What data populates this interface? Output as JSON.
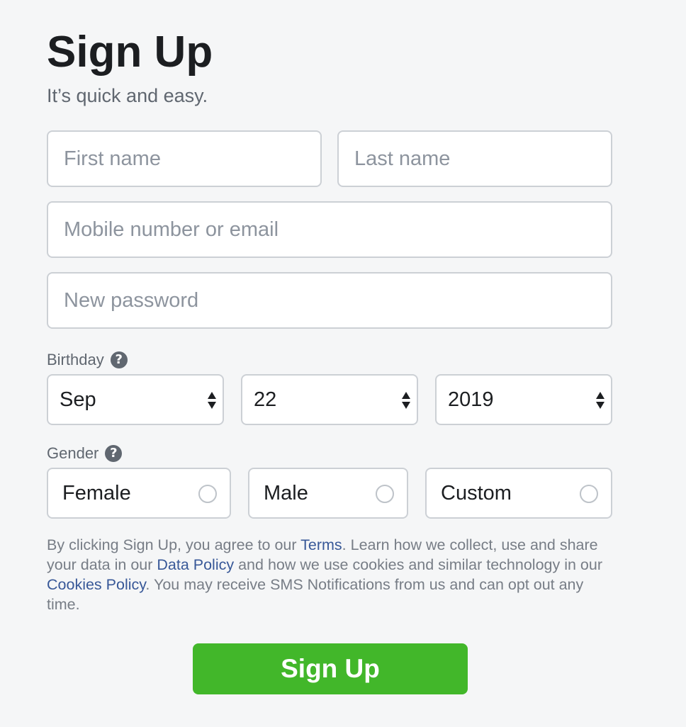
{
  "header": {
    "title": "Sign Up",
    "subtitle": "It’s quick and easy."
  },
  "form": {
    "first_name": {
      "placeholder": "First name",
      "value": ""
    },
    "last_name": {
      "placeholder": "Last name",
      "value": ""
    },
    "contact": {
      "placeholder": "Mobile number or email",
      "value": ""
    },
    "password": {
      "placeholder": "New password",
      "value": ""
    }
  },
  "birthday": {
    "label": "Birthday",
    "help_icon": "question-circle-icon",
    "month": "Sep",
    "day": "22",
    "year": "2019"
  },
  "gender": {
    "label": "Gender",
    "help_icon": "question-circle-icon",
    "options": [
      {
        "label": "Female",
        "selected": false
      },
      {
        "label": "Male",
        "selected": false
      },
      {
        "label": "Custom",
        "selected": false
      }
    ]
  },
  "terms": {
    "part1": "By clicking Sign Up, you agree to our ",
    "terms_link": "Terms",
    "part2": ". Learn how we collect, use and share your data in our ",
    "data_policy_link": "Data Policy",
    "part3": " and how we use cookies and similar technology in our ",
    "cookies_policy_link": "Cookies Policy",
    "part4": ". You may receive SMS Notifications from us and can opt out any time."
  },
  "submit": {
    "label": "Sign Up"
  },
  "colors": {
    "background": "#f5f6f7",
    "button_green": "#42b72a",
    "link_blue": "#385898",
    "border": "#ccd0d5"
  }
}
